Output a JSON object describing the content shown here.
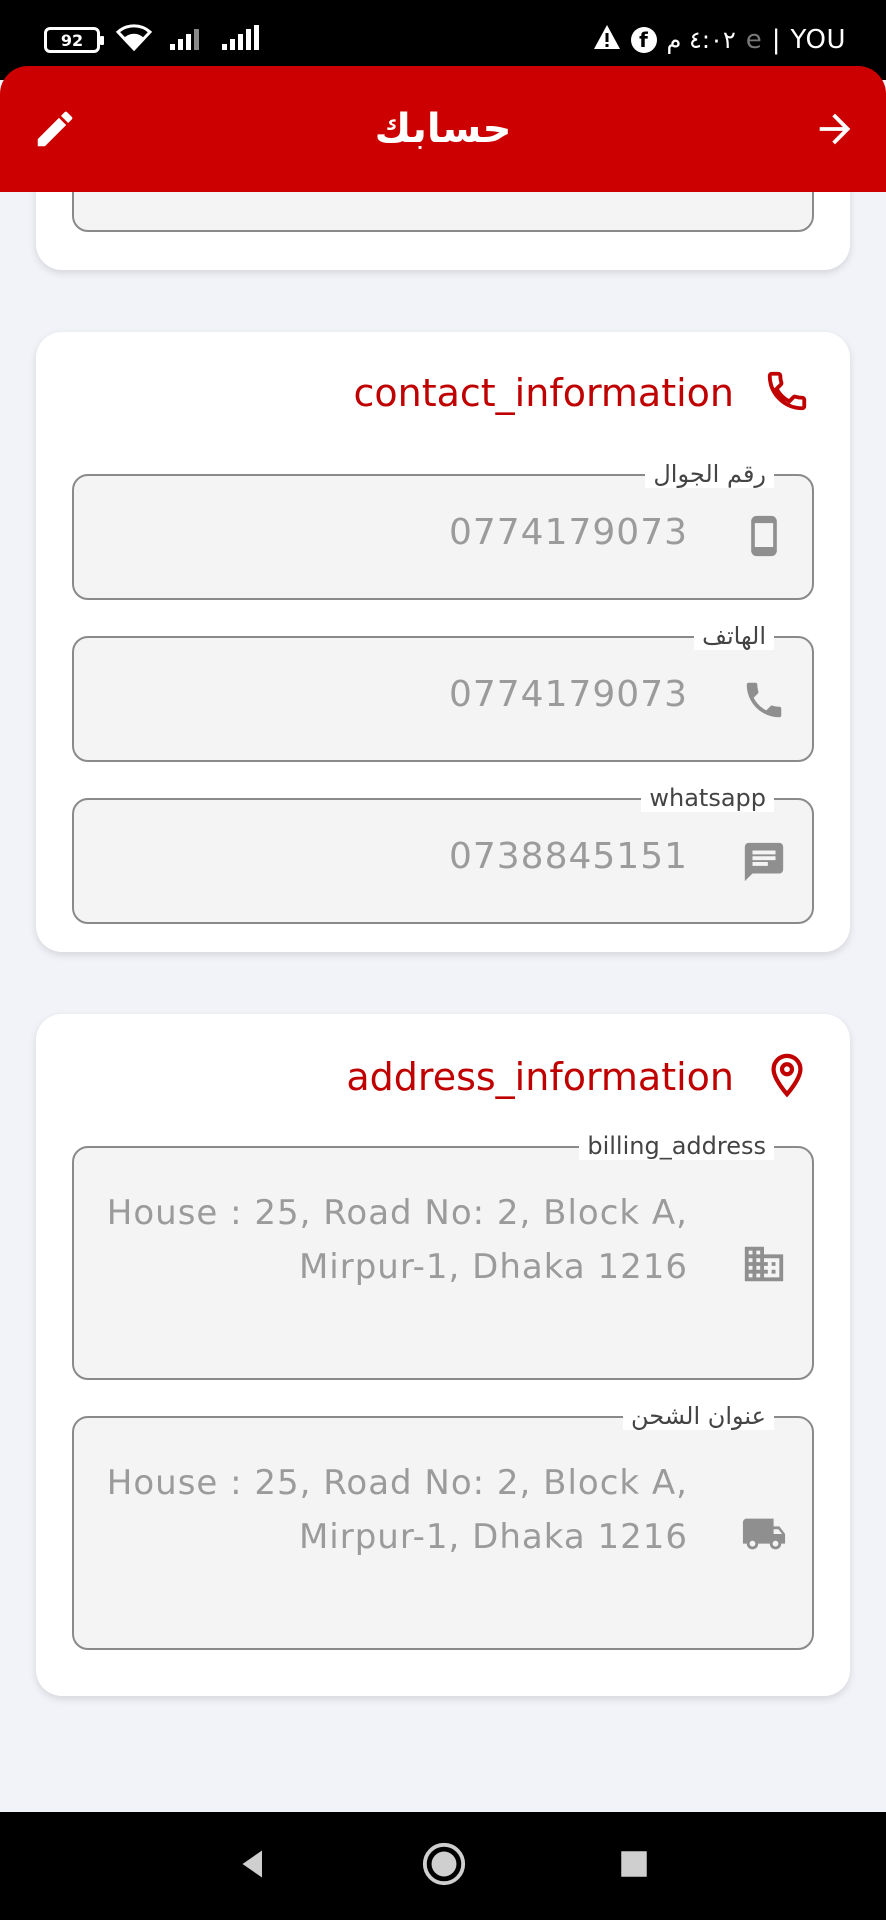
{
  "status_bar": {
    "battery": "92",
    "carrier": "YOU",
    "time": "٤:٠٢ م",
    "separator": "|",
    "extra": "e"
  },
  "app_bar": {
    "title": "حسابك"
  },
  "contact_card": {
    "title": "contact_information",
    "fields": [
      {
        "label": "رقم الجوال",
        "value": "0774179073",
        "icon": "mobile-phone-icon"
      },
      {
        "label": "الهاتف",
        "value": "0774179073",
        "icon": "phone-icon"
      },
      {
        "label": "whatsapp",
        "value": "0738845151",
        "icon": "message-icon"
      }
    ]
  },
  "address_card": {
    "title": "address_information",
    "fields": [
      {
        "label": "billing_address",
        "line1": "House : 25, Road No: 2, Block A,",
        "line2": "Mirpur-1, Dhaka 1216",
        "icon": "building-icon"
      },
      {
        "label": "عنوان الشحن",
        "line1": "House : 25, Road No: 2, Block A,",
        "line2": "Mirpur-1, Dhaka 1216",
        "icon": "truck-icon"
      }
    ]
  },
  "colors": {
    "accent": "#cc0000",
    "title_red": "#c00000",
    "background": "#f1f3f8",
    "field_bg": "#f4f4f4",
    "field_text": "#9b9b9b",
    "icon_gray": "#8f8f8f"
  }
}
